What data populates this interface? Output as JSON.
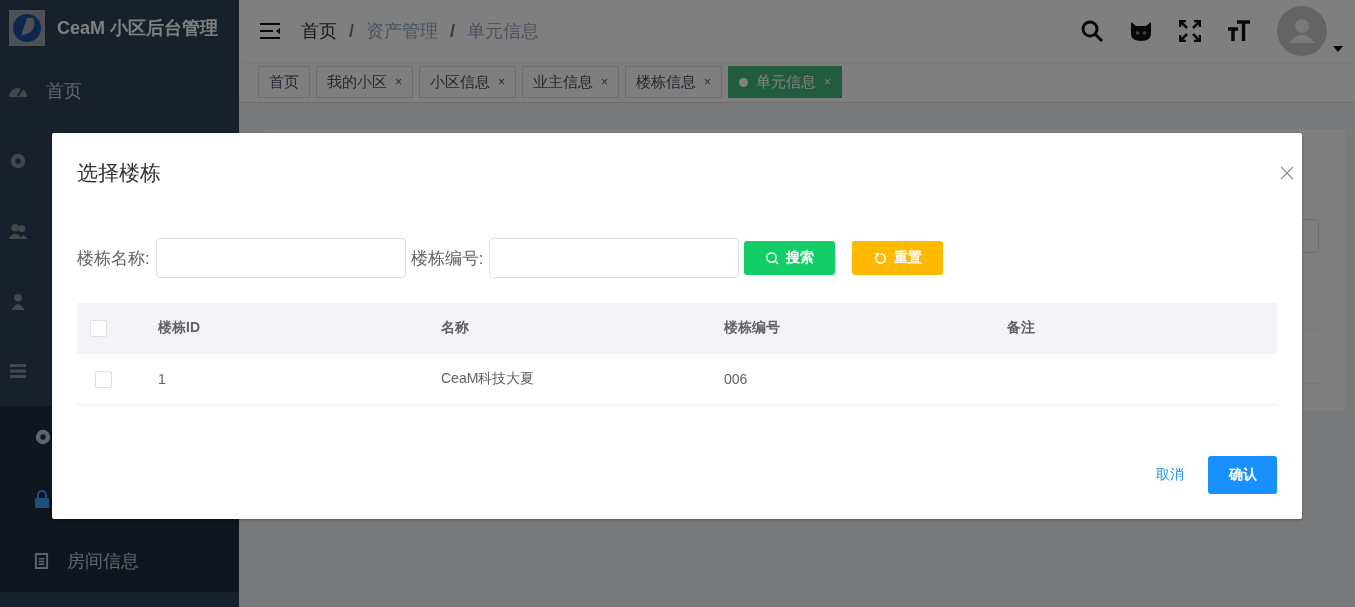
{
  "app_title": "CeaM 小区后台管理",
  "sidebar": {
    "items": [
      {
        "kind": "dashboard",
        "label": "首页"
      },
      {
        "kind": "gear"
      },
      {
        "kind": "people"
      },
      {
        "kind": "person"
      },
      {
        "kind": "list",
        "children": [
          {
            "kind": "gear",
            "selected": false
          },
          {
            "kind": "lock",
            "selected": true
          },
          {
            "kind": "document",
            "label": "房间信息",
            "selected": false
          }
        ]
      }
    ]
  },
  "breadcrumb": [
    "首页",
    "资产管理",
    "单元信息"
  ],
  "breadcrumb_separator": "/",
  "tags": [
    {
      "label": "首页",
      "selected": false,
      "closable": false
    },
    {
      "label": "我的小区",
      "selected": false,
      "closable": true
    },
    {
      "label": "小区信息",
      "selected": false,
      "closable": true
    },
    {
      "label": "业主信息",
      "selected": false,
      "closable": true
    },
    {
      "label": "楼栋信息",
      "selected": false,
      "closable": true
    },
    {
      "label": "单元信息",
      "selected": true,
      "closable": true
    }
  ],
  "tag_close": "×",
  "dialog": {
    "title": "选择楼栋",
    "filters": [
      {
        "label": "楼栋名称:"
      },
      {
        "label": "楼栋编号:"
      }
    ],
    "buttons": [
      {
        "kind": "search",
        "label": "搜索"
      },
      {
        "kind": "reset",
        "label": "重置"
      }
    ],
    "table": {
      "all_checked": false,
      "columns": [
        "楼栋ID",
        "名称",
        "楼栋编号",
        "备注"
      ],
      "rows": [
        {
          "checked": false,
          "cells": [
            "1",
            "CeaM科技大夏",
            "006",
            ""
          ]
        }
      ]
    },
    "cancel": "取消",
    "confirm": "确认"
  }
}
